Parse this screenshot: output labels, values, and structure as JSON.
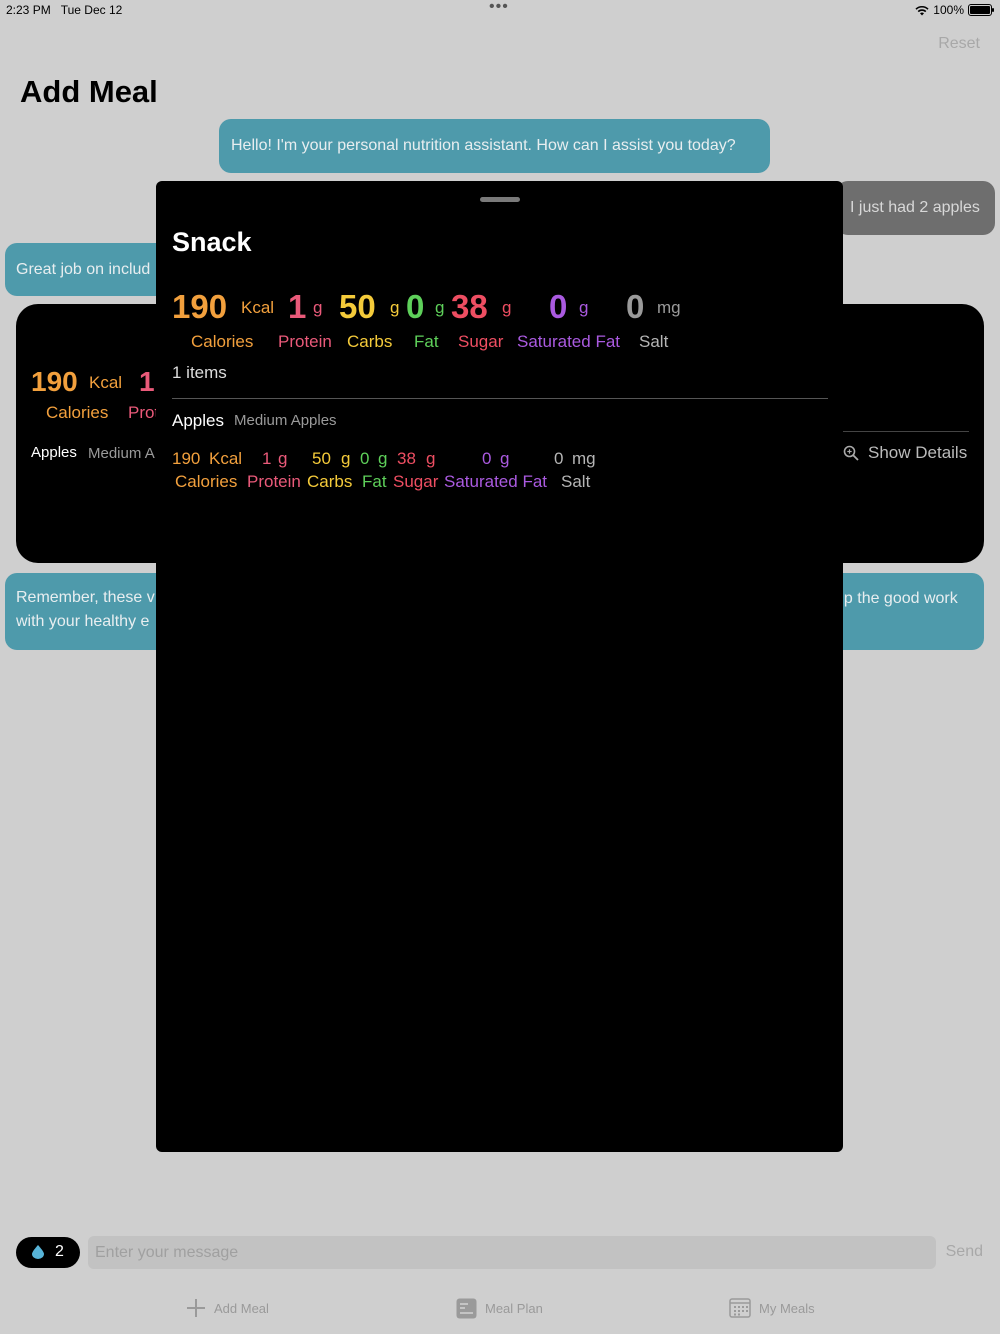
{
  "status": {
    "time": "2:23 PM",
    "date": "Tue Dec 12",
    "battery": "100%"
  },
  "header": {
    "reset": "Reset",
    "title": "Add Meal"
  },
  "chat": {
    "assistant_greeting": "Hello! I'm your personal nutrition assistant. How can I assist you today?",
    "user_message": "I just had 2 apples",
    "assistant_reply_partial": "Great job on includ",
    "assistant_followup_left": [
      "Remember, these v",
      "with your healthy e"
    ],
    "assistant_followup_right": "up the good work"
  },
  "bg_card": {
    "calories": "190",
    "kcal": "Kcal",
    "protein_partial": "1",
    "calories_label": "Calories",
    "protein_partial_label": "Prot",
    "food_name": "Apples",
    "food_desc_partial": "Medium A",
    "show_details": "Show Details"
  },
  "sheet": {
    "title": "Snack",
    "totals": {
      "calories": {
        "value": "190",
        "unit": "Kcal",
        "label": "Calories"
      },
      "protein": {
        "value": "1",
        "unit": "g",
        "label": "Protein"
      },
      "carbs": {
        "value": "50",
        "unit": "g",
        "label": "Carbs"
      },
      "fat": {
        "value": "0",
        "unit": "g",
        "label": "Fat"
      },
      "sugar": {
        "value": "38",
        "unit": "g",
        "label": "Sugar"
      },
      "saturated_fat": {
        "value": "0",
        "unit": "g",
        "label": "Saturated Fat"
      },
      "salt": {
        "value": "0",
        "unit": "mg",
        "label": "Salt"
      }
    },
    "items_count": "1 items",
    "items": [
      {
        "name": "Apples",
        "desc": "Medium Apples",
        "calories": "190",
        "calories_unit": "Kcal",
        "protein": "1",
        "protein_unit": "g",
        "carbs": "50",
        "carbs_unit": "g",
        "fat": "0",
        "fat_unit": "g",
        "sugar": "38",
        "sugar_unit": "g",
        "saturated_fat": "0",
        "saturated_fat_unit": "g",
        "salt": "0",
        "salt_unit": "mg",
        "labels": {
          "calories": "Calories",
          "protein": "Protein",
          "carbs": "Carbs",
          "fat": "Fat",
          "sugar": "Sugar",
          "saturated_fat": "Saturated Fat",
          "salt": "Salt"
        }
      }
    ]
  },
  "composer": {
    "water_count": "2",
    "placeholder": "Enter your message",
    "send": "Send"
  },
  "tabs": [
    {
      "label": "Add Meal",
      "icon": "plus-icon"
    },
    {
      "label": "Meal Plan",
      "icon": "meal-plan-icon"
    },
    {
      "label": "My Meals",
      "icon": "calendar-icon"
    }
  ],
  "colors": {
    "calories": "#f2a03d",
    "protein": "#ea5a7a",
    "carbs": "#f5cb3a",
    "fat": "#5ed05a",
    "sugar": "#ee4e62",
    "saturated_fat": "#aa5ae0",
    "salt": "#9a9a9a",
    "assistant_bubble": "#4e9aab",
    "user_bubble": "#6e6e6e"
  }
}
